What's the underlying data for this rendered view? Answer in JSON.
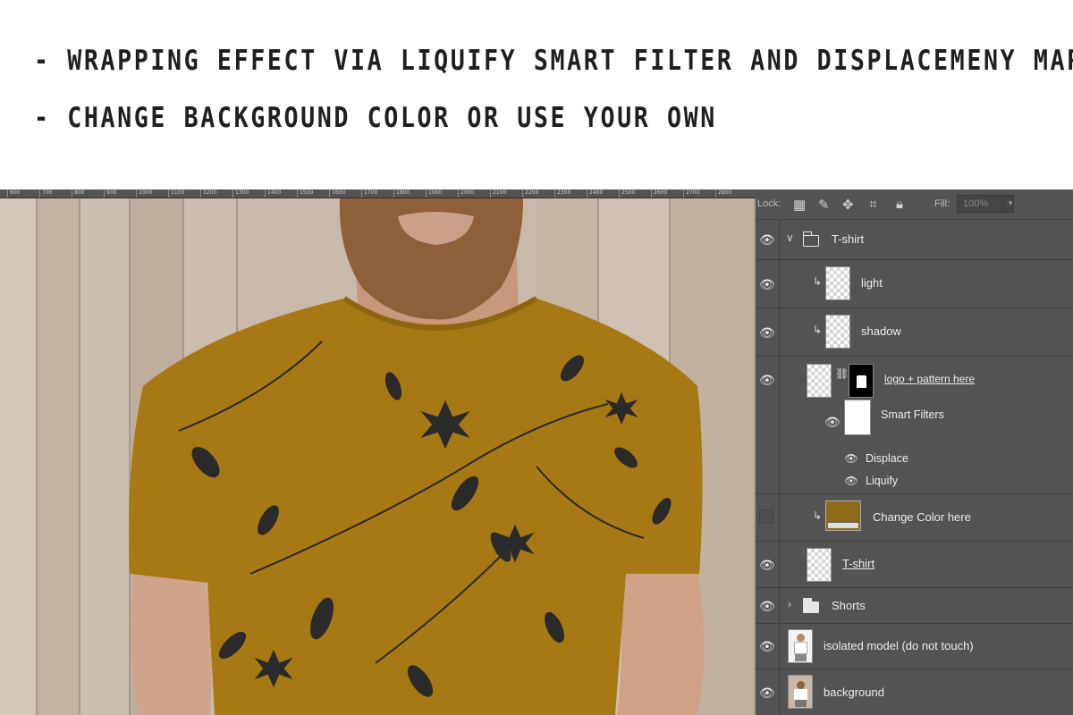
{
  "header": {
    "line1": "- WRAPPING EFFECT VIA LIQUIFY SMART FILTER AND DISPLACEMENY MAP",
    "line2": "- CHANGE BACKGROUND COLOR OR USE YOUR OWN"
  },
  "ruler": {
    "ticks": [
      "600",
      "700",
      "800",
      "900",
      "1000",
      "1100",
      "1200",
      "1300",
      "1400",
      "1500",
      "1600",
      "1700",
      "1800",
      "1900",
      "2000",
      "2100",
      "2200",
      "2300",
      "2400",
      "2500",
      "2600",
      "2700",
      "2800"
    ]
  },
  "layers_panel": {
    "lock_label": "Lock:",
    "fill_label": "Fill:",
    "fill_value": "100%",
    "toolbar_icons": [
      "lock-transparent-icon",
      "brush-icon",
      "move-icon",
      "crop-icon",
      "lock-icon"
    ],
    "layers": [
      {
        "name": "T-shirt",
        "type": "group",
        "expanded": true,
        "visible": true
      },
      {
        "name": "light",
        "type": "layer",
        "clipped": true,
        "visible": true
      },
      {
        "name": "shadow",
        "type": "layer",
        "clipped": true,
        "visible": true
      },
      {
        "name": "logo + pattern here",
        "type": "smart-object",
        "visible": true
      },
      {
        "name": "Smart Filters",
        "type": "smart-filters",
        "visible": true
      },
      {
        "name": "Displace",
        "type": "filter",
        "visible": true
      },
      {
        "name": "Liquify",
        "type": "filter",
        "visible": true
      },
      {
        "name": "Change Color here",
        "type": "fill-layer",
        "clipped": true,
        "visible": false,
        "color": "#8c6a18"
      },
      {
        "name": "T-shirt",
        "type": "smart-object",
        "visible": true
      },
      {
        "name": "Shorts",
        "type": "group",
        "expanded": false,
        "visible": true
      },
      {
        "name": "isolated model (do not touch)",
        "type": "layer",
        "visible": true
      },
      {
        "name": "background",
        "type": "layer",
        "visible": true
      }
    ]
  },
  "colors": {
    "shirt": "#a77914",
    "panel_bg": "#535353",
    "wood": "#c8b9ab"
  }
}
